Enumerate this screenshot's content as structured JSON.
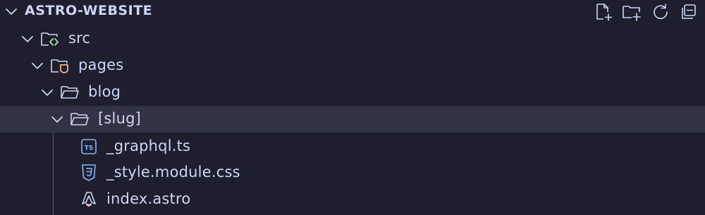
{
  "explorer": {
    "title": "ASTRO-WEBSITE",
    "actions": {
      "new_file_icon": "new-file-icon",
      "new_folder_icon": "new-folder-icon",
      "refresh_icon": "refresh-icon",
      "collapse_all_icon": "collapse-all-icon"
    }
  },
  "tree": [
    {
      "label": "src",
      "type": "folder",
      "expanded": true
    },
    {
      "label": "pages",
      "type": "folder",
      "expanded": true
    },
    {
      "label": "blog",
      "type": "folder",
      "expanded": true
    },
    {
      "label": "[slug]",
      "type": "folder",
      "expanded": true,
      "selected": true
    },
    {
      "label": "_graphql.ts",
      "type": "file",
      "icon": "typescript-icon"
    },
    {
      "label": "_style.module.css",
      "type": "file",
      "icon": "css-icon"
    },
    {
      "label": "index.astro",
      "type": "file",
      "icon": "astro-icon"
    }
  ],
  "colors": {
    "background": "#1e1e2e",
    "selected_row": "#313244",
    "text": "#cdd6f4",
    "icon": "#cdd6f4",
    "src_badge": "#a6e3a1",
    "pages_badge": "#fab387",
    "ts_icon": "#89b4fa",
    "css_icon": "#89b4fa",
    "astro_icon": "#f5c2e7"
  }
}
